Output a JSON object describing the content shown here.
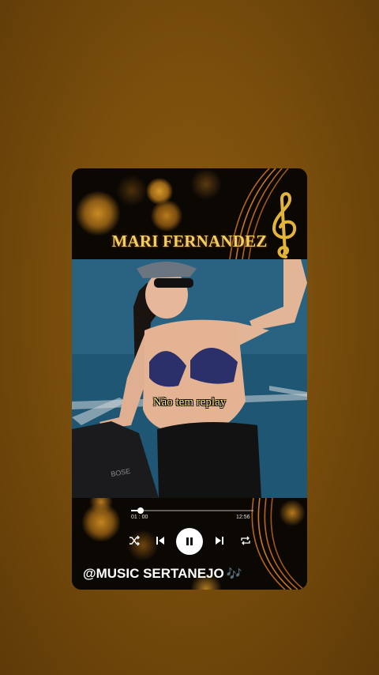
{
  "header": {
    "title": "MARI FERNANDEZ",
    "clef_icon": "treble-clef-icon"
  },
  "video": {
    "subtitle": "Não tem replay"
  },
  "player": {
    "elapsed": "01 : 00",
    "duration": "12:56",
    "progress": 0.08,
    "controls": {
      "shuffle": "shuffle-icon",
      "previous": "skip-previous-icon",
      "play_pause": "pause-icon",
      "next": "skip-next-icon",
      "repeat": "repeat-icon"
    }
  },
  "footer": {
    "handle": "@MUSIC SERTANEJO",
    "emoji": "🎶"
  }
}
